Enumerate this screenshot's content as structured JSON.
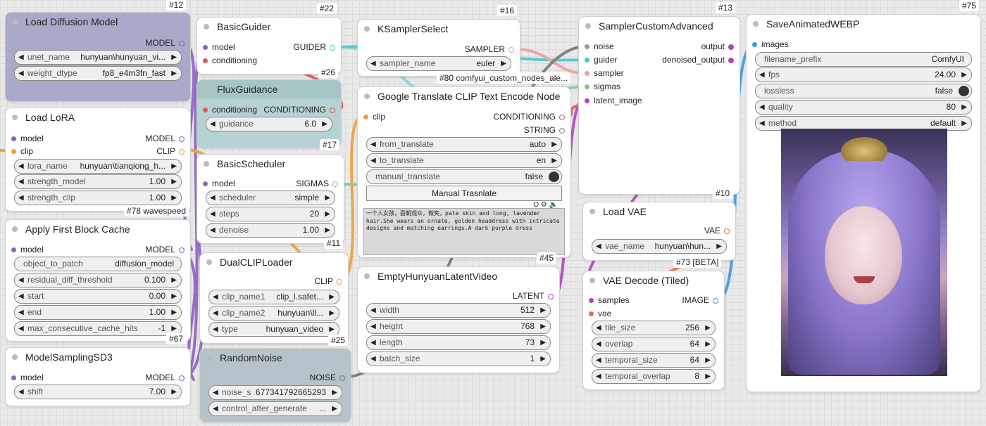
{
  "colors": {
    "model": "#8f5fc4",
    "clip": "#f0a030",
    "conditioning": "#e25656",
    "latent": "#b043c2",
    "image": "#3a9ae0",
    "vae": "#f06a40",
    "guider": "#48c8d0",
    "sampler": "#eba0a0",
    "sigmas": "#80c890",
    "noise": "#777777",
    "string": "#888888"
  },
  "nodes": {
    "load_diffusion": {
      "id": "#12",
      "title": "Load Diffusion Model",
      "output": "MODEL",
      "widgets": [
        {
          "label": "unet_name",
          "value": "hunyuan\\hunyuan_vi..."
        },
        {
          "label": "weight_dtype",
          "value": "fp8_e4m3fn_fast"
        }
      ]
    },
    "load_lora": {
      "hidden_badge": "#67",
      "title": "Load LoRA",
      "inputs": [
        "model",
        "clip"
      ],
      "outputs": [
        "MODEL",
        "CLIP"
      ],
      "widgets": [
        {
          "label": "lora_name",
          "value": "hunyuan\\tianqiong_h..."
        },
        {
          "label": "strength_model",
          "value": "1.00"
        },
        {
          "label": "strength_clip",
          "value": "1.00"
        }
      ]
    },
    "apply_cache": {
      "id": "#78 wavespeed",
      "title": "Apply First Block Cache",
      "inputs": [
        "model"
      ],
      "outputs": [
        "MODEL"
      ],
      "widgets": [
        {
          "label": "object_to_patch",
          "value": "diffusion_model"
        },
        {
          "label": "residual_diff_threshold",
          "value": "0.100"
        },
        {
          "label": "start",
          "value": "0.00"
        },
        {
          "label": "end",
          "value": "1.00"
        },
        {
          "label": "max_consecutive_cache_hits",
          "value": "-1"
        }
      ]
    },
    "model_sampling": {
      "id": "#67",
      "title": "ModelSamplingSD3",
      "inputs": [
        "model"
      ],
      "outputs": [
        "MODEL"
      ],
      "widgets": [
        {
          "label": "shift",
          "value": "7.00"
        }
      ]
    },
    "basic_guider": {
      "id": "#22",
      "title": "BasicGuider",
      "inputs": [
        "model",
        "conditioning"
      ],
      "outputs": [
        "GUIDER"
      ]
    },
    "flux_guidance": {
      "id": "#26",
      "title": "FluxGuidance",
      "inputs": [
        "conditioning"
      ],
      "outputs": [
        "CONDITIONING"
      ],
      "widgets": [
        {
          "label": "guidance",
          "value": "6.0"
        }
      ]
    },
    "basic_scheduler": {
      "id": "#17",
      "title": "BasicScheduler",
      "inputs": [
        "model"
      ],
      "outputs": [
        "SIGMAS"
      ],
      "widgets": [
        {
          "label": "scheduler",
          "value": "simple"
        },
        {
          "label": "steps",
          "value": "20"
        },
        {
          "label": "denoise",
          "value": "1.00"
        }
      ]
    },
    "dual_clip": {
      "id": "#11",
      "title": "DualCLIPLoader",
      "outputs": [
        "CLIP"
      ],
      "widgets": [
        {
          "label": "clip_name1",
          "value": "clip_l.safet..."
        },
        {
          "label": "clip_name2",
          "value": "hunyuan\\ll..."
        },
        {
          "label": "type",
          "value": "hunyuan_video"
        }
      ]
    },
    "random_noise": {
      "id": "#25",
      "title": "RandomNoise",
      "outputs": [
        "NOISE"
      ],
      "widgets": [
        {
          "label": "noise_s",
          "value": "677341792665293"
        },
        {
          "label": "control_after_generate",
          "value": "..."
        }
      ]
    },
    "ksampler_select": {
      "id": "#16",
      "title": "KSamplerSelect",
      "outputs": [
        "SAMPLER"
      ],
      "widgets": [
        {
          "label": "sampler_name",
          "value": "euler"
        }
      ]
    },
    "google_translate": {
      "id": "#80 comfyui_custom_nodes_ale...",
      "title": "Google Translate CLIP Text Encode Node",
      "inputs": [
        "clip"
      ],
      "outputs": [
        "CONDITIONING",
        "STRING"
      ],
      "widgets": [
        {
          "label": "from_translate",
          "value": "auto"
        },
        {
          "label": "to_translate",
          "value": "en"
        },
        {
          "label": "manual_translate",
          "value": "false"
        }
      ],
      "button": "Manual Trasnlate",
      "mini_icons": "O ⚙ 🔈",
      "text_lines": [
        "一个人女孩，面朝观众，微笑，pale skin and long, lavender",
        "hair.She wears an ornate, golden headdress with intricate",
        "designs and matching earrings.A dark purple dress"
      ]
    },
    "empty_latent": {
      "id": "#45",
      "title": "EmptyHunyuanLatentVideo",
      "outputs": [
        "LATENT"
      ],
      "widgets": [
        {
          "label": "width",
          "value": "512"
        },
        {
          "label": "height",
          "value": "768"
        },
        {
          "label": "length",
          "value": "73"
        },
        {
          "label": "batch_size",
          "value": "1"
        }
      ]
    },
    "sampler_custom": {
      "id": "#13",
      "title": "SamplerCustomAdvanced",
      "inputs": [
        "noise",
        "guider",
        "sampler",
        "sigmas",
        "latent_image"
      ],
      "outputs": [
        "output",
        "denoised_output"
      ]
    },
    "load_vae": {
      "id": "#10",
      "title": "Load VAE",
      "outputs": [
        "VAE"
      ],
      "widgets": [
        {
          "label": "vae_name",
          "value": "hunyuan\\hun..."
        }
      ]
    },
    "vae_decode": {
      "id": "#73 [BETA]",
      "title": "VAE Decode (Tiled)",
      "inputs": [
        "samples",
        "vae"
      ],
      "outputs": [
        "IMAGE"
      ],
      "widgets": [
        {
          "label": "tile_size",
          "value": "256"
        },
        {
          "label": "overlap",
          "value": "64"
        },
        {
          "label": "temporal_size",
          "value": "64"
        },
        {
          "label": "temporal_overlap",
          "value": "8"
        }
      ]
    },
    "save_webp": {
      "id": "#75",
      "title": "SaveAnimatedWEBP",
      "inputs": [
        "images"
      ],
      "widgets": [
        {
          "label": "filename_prefix",
          "value": "ComfyUI"
        },
        {
          "label": "fps",
          "value": "24.00"
        },
        {
          "label": "lossless",
          "value": "false"
        },
        {
          "label": "quality",
          "value": "80"
        },
        {
          "label": "method",
          "value": "default"
        }
      ]
    }
  }
}
